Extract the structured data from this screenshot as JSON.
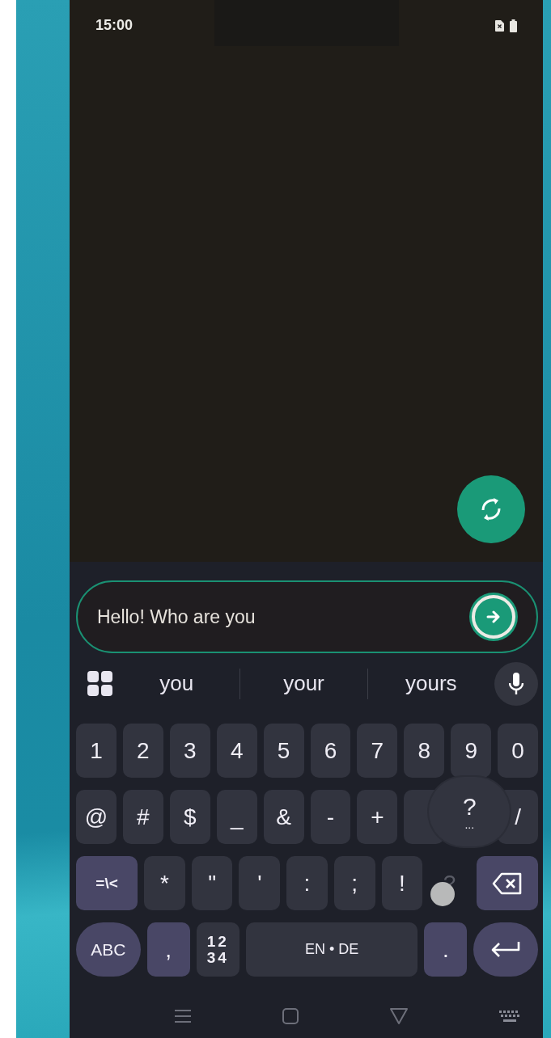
{
  "status_bar": {
    "time": "15:00"
  },
  "message_field": {
    "value": "Hello! Who are you"
  },
  "suggestions": [
    "you",
    "your",
    "yours"
  ],
  "keyboard": {
    "number_row": [
      {
        "kind": "char",
        "label": "1"
      },
      {
        "kind": "char",
        "label": "2"
      },
      {
        "kind": "char",
        "label": "3"
      },
      {
        "kind": "char",
        "label": "4"
      },
      {
        "kind": "char",
        "label": "5"
      },
      {
        "kind": "char",
        "label": "6"
      },
      {
        "kind": "char",
        "label": "7"
      },
      {
        "kind": "char",
        "label": "8"
      },
      {
        "kind": "char",
        "label": "9"
      },
      {
        "kind": "char",
        "label": "0"
      }
    ],
    "symbol_row": [
      {
        "kind": "char",
        "label": "@"
      },
      {
        "kind": "char",
        "label": "#"
      },
      {
        "kind": "char",
        "label": "$"
      },
      {
        "kind": "char",
        "label": "_"
      },
      {
        "kind": "char",
        "label": "&"
      },
      {
        "kind": "char",
        "label": "-"
      },
      {
        "kind": "char",
        "label": "+"
      },
      {
        "kind": "covered"
      },
      {
        "kind": "popup",
        "label": "?",
        "more": "..."
      },
      {
        "kind": "char",
        "label": "/"
      }
    ],
    "punctuation_row": [
      {
        "kind": "function",
        "label": "=\\<"
      },
      {
        "kind": "char",
        "label": "*"
      },
      {
        "kind": "char",
        "label": "\""
      },
      {
        "kind": "char",
        "label": "'"
      },
      {
        "kind": "char",
        "label": ":"
      },
      {
        "kind": "char",
        "label": ";"
      },
      {
        "kind": "char",
        "label": "!"
      },
      {
        "kind": "touched",
        "label": "?"
      },
      {
        "kind": "backspace"
      }
    ],
    "bottom_row": [
      {
        "kind": "abc",
        "label": "ABC"
      },
      {
        "kind": "function",
        "label": ","
      },
      {
        "kind": "stacked",
        "lines": [
          "12",
          "34"
        ]
      },
      {
        "kind": "space",
        "label": "EN • DE"
      },
      {
        "kind": "function",
        "label": "."
      },
      {
        "kind": "enter"
      }
    ]
  }
}
